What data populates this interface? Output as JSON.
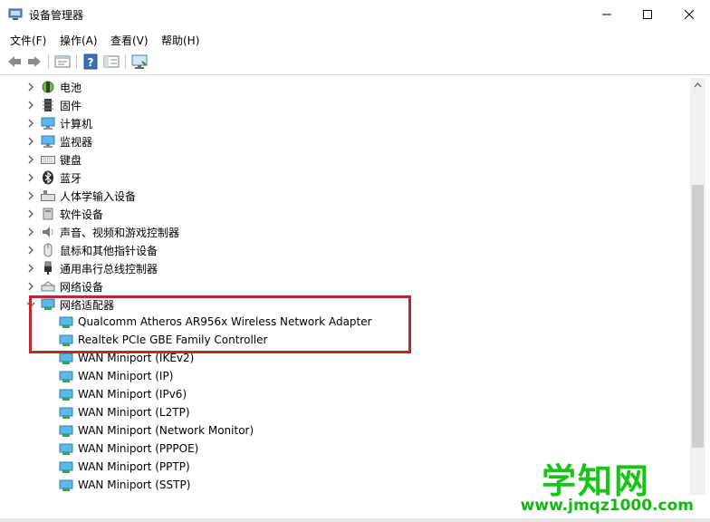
{
  "window": {
    "title": "设备管理器"
  },
  "menu": [
    {
      "label": "文件(F)"
    },
    {
      "label": "操作(A)"
    },
    {
      "label": "查看(V)"
    },
    {
      "label": "帮助(H)"
    }
  ],
  "toolbar": [
    "back-icon",
    "forward-icon",
    "properties-icon",
    "help-icon",
    "show-hide-icon",
    "monitor-icon"
  ],
  "tree": {
    "categories_top": [
      {
        "label": "电池",
        "icon": "battery-icon"
      },
      {
        "label": "固件",
        "icon": "firmware-icon"
      },
      {
        "label": "计算机",
        "icon": "computer-icon"
      },
      {
        "label": "监视器",
        "icon": "monitor-icon"
      },
      {
        "label": "键盘",
        "icon": "keyboard-icon"
      },
      {
        "label": "蓝牙",
        "icon": "bluetooth-icon"
      },
      {
        "label": "人体学输入设备",
        "icon": "hid-icon"
      },
      {
        "label": "软件设备",
        "icon": "software-device-icon"
      },
      {
        "label": "声音、视频和游戏控制器",
        "icon": "speaker-icon"
      },
      {
        "label": "鼠标和其他指针设备",
        "icon": "mouse-icon"
      },
      {
        "label": "通用串行总线控制器",
        "icon": "usb-icon"
      },
      {
        "label": "网络设备",
        "icon": "network-device-icon"
      }
    ],
    "network_adapters": {
      "label": "网络适配器",
      "children": [
        {
          "label": "Qualcomm Atheros AR956x Wireless Network Adapter"
        },
        {
          "label": "Realtek PCIe GBE Family Controller"
        },
        {
          "label": "WAN Miniport (IKEv2)"
        },
        {
          "label": "WAN Miniport (IP)"
        },
        {
          "label": "WAN Miniport (IPv6)"
        },
        {
          "label": "WAN Miniport (L2TP)"
        },
        {
          "label": "WAN Miniport (Network Monitor)"
        },
        {
          "label": "WAN Miniport (PPPOE)"
        },
        {
          "label": "WAN Miniport (PPTP)"
        },
        {
          "label": "WAN Miniport (SSTP)"
        }
      ]
    }
  },
  "watermark": {
    "main": "学知网",
    "url": "www.jmqz1000.com"
  },
  "colors": {
    "highlight": "#c0272d",
    "watermark": "#18c418"
  }
}
